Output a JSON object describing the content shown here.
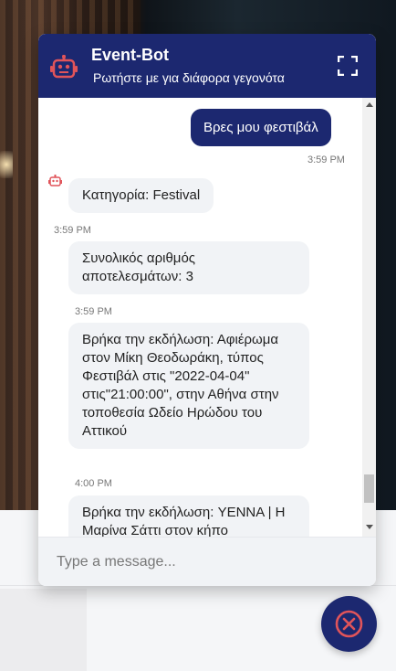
{
  "header": {
    "title": "Event-Bot",
    "subtitle": "Ρωτήστε με για διάφορα γεγονότα",
    "icons": {
      "avatar": "robot-icon",
      "expand": "fullscreen-icon"
    }
  },
  "messages": [
    {
      "from": "user",
      "text": "Βρες μου φεστιβάλ",
      "time": "3:59 PM"
    },
    {
      "from": "bot",
      "text": "Κατηγορία: Festival",
      "time": "3:59 PM"
    },
    {
      "from": "bot",
      "text": "Συνολικός αριθμός αποτελεσμάτων: 3",
      "time": "3:59 PM"
    },
    {
      "from": "bot",
      "text": "Βρήκα την εκδήλωση: Αφιέρωμα στον Μίκη Θεοδωράκη, τύπος Φεστιβάλ στις \"2022-04-04\" στις\"21:00:00\", στην Αθήνα στην τοποθεσία Ωδείο Ηρώδου του Αττικού",
      "time": "4:00 PM"
    },
    {
      "from": "bot",
      "text": "Βρήκα την εκδήλωση: YENNA | Η Μαρίνα Σάττι στον κήπο"
    }
  ],
  "input": {
    "placeholder": "Type a message..."
  },
  "close_button": {
    "icon": "close-circle-icon"
  },
  "colors": {
    "brand": "#1c2870",
    "accent": "#e0545a",
    "bubble": "#f1f3f6"
  }
}
